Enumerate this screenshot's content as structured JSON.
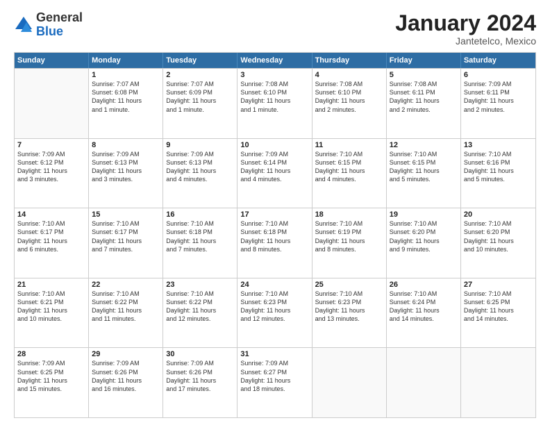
{
  "logo": {
    "general": "General",
    "blue": "Blue"
  },
  "title": "January 2024",
  "subtitle": "Jantetelco, Mexico",
  "header": {
    "days": [
      "Sunday",
      "Monday",
      "Tuesday",
      "Wednesday",
      "Thursday",
      "Friday",
      "Saturday"
    ]
  },
  "weeks": [
    [
      {
        "day": "",
        "info": ""
      },
      {
        "day": "1",
        "info": "Sunrise: 7:07 AM\nSunset: 6:08 PM\nDaylight: 11 hours\nand 1 minute."
      },
      {
        "day": "2",
        "info": "Sunrise: 7:07 AM\nSunset: 6:09 PM\nDaylight: 11 hours\nand 1 minute."
      },
      {
        "day": "3",
        "info": "Sunrise: 7:08 AM\nSunset: 6:10 PM\nDaylight: 11 hours\nand 1 minute."
      },
      {
        "day": "4",
        "info": "Sunrise: 7:08 AM\nSunset: 6:10 PM\nDaylight: 11 hours\nand 2 minutes."
      },
      {
        "day": "5",
        "info": "Sunrise: 7:08 AM\nSunset: 6:11 PM\nDaylight: 11 hours\nand 2 minutes."
      },
      {
        "day": "6",
        "info": "Sunrise: 7:09 AM\nSunset: 6:11 PM\nDaylight: 11 hours\nand 2 minutes."
      }
    ],
    [
      {
        "day": "7",
        "info": "Sunrise: 7:09 AM\nSunset: 6:12 PM\nDaylight: 11 hours\nand 3 minutes."
      },
      {
        "day": "8",
        "info": "Sunrise: 7:09 AM\nSunset: 6:13 PM\nDaylight: 11 hours\nand 3 minutes."
      },
      {
        "day": "9",
        "info": "Sunrise: 7:09 AM\nSunset: 6:13 PM\nDaylight: 11 hours\nand 4 minutes."
      },
      {
        "day": "10",
        "info": "Sunrise: 7:09 AM\nSunset: 6:14 PM\nDaylight: 11 hours\nand 4 minutes."
      },
      {
        "day": "11",
        "info": "Sunrise: 7:10 AM\nSunset: 6:15 PM\nDaylight: 11 hours\nand 4 minutes."
      },
      {
        "day": "12",
        "info": "Sunrise: 7:10 AM\nSunset: 6:15 PM\nDaylight: 11 hours\nand 5 minutes."
      },
      {
        "day": "13",
        "info": "Sunrise: 7:10 AM\nSunset: 6:16 PM\nDaylight: 11 hours\nand 5 minutes."
      }
    ],
    [
      {
        "day": "14",
        "info": "Sunrise: 7:10 AM\nSunset: 6:17 PM\nDaylight: 11 hours\nand 6 minutes."
      },
      {
        "day": "15",
        "info": "Sunrise: 7:10 AM\nSunset: 6:17 PM\nDaylight: 11 hours\nand 7 minutes."
      },
      {
        "day": "16",
        "info": "Sunrise: 7:10 AM\nSunset: 6:18 PM\nDaylight: 11 hours\nand 7 minutes."
      },
      {
        "day": "17",
        "info": "Sunrise: 7:10 AM\nSunset: 6:18 PM\nDaylight: 11 hours\nand 8 minutes."
      },
      {
        "day": "18",
        "info": "Sunrise: 7:10 AM\nSunset: 6:19 PM\nDaylight: 11 hours\nand 8 minutes."
      },
      {
        "day": "19",
        "info": "Sunrise: 7:10 AM\nSunset: 6:20 PM\nDaylight: 11 hours\nand 9 minutes."
      },
      {
        "day": "20",
        "info": "Sunrise: 7:10 AM\nSunset: 6:20 PM\nDaylight: 11 hours\nand 10 minutes."
      }
    ],
    [
      {
        "day": "21",
        "info": "Sunrise: 7:10 AM\nSunset: 6:21 PM\nDaylight: 11 hours\nand 10 minutes."
      },
      {
        "day": "22",
        "info": "Sunrise: 7:10 AM\nSunset: 6:22 PM\nDaylight: 11 hours\nand 11 minutes."
      },
      {
        "day": "23",
        "info": "Sunrise: 7:10 AM\nSunset: 6:22 PM\nDaylight: 11 hours\nand 12 minutes."
      },
      {
        "day": "24",
        "info": "Sunrise: 7:10 AM\nSunset: 6:23 PM\nDaylight: 11 hours\nand 12 minutes."
      },
      {
        "day": "25",
        "info": "Sunrise: 7:10 AM\nSunset: 6:23 PM\nDaylight: 11 hours\nand 13 minutes."
      },
      {
        "day": "26",
        "info": "Sunrise: 7:10 AM\nSunset: 6:24 PM\nDaylight: 11 hours\nand 14 minutes."
      },
      {
        "day": "27",
        "info": "Sunrise: 7:10 AM\nSunset: 6:25 PM\nDaylight: 11 hours\nand 14 minutes."
      }
    ],
    [
      {
        "day": "28",
        "info": "Sunrise: 7:09 AM\nSunset: 6:25 PM\nDaylight: 11 hours\nand 15 minutes."
      },
      {
        "day": "29",
        "info": "Sunrise: 7:09 AM\nSunset: 6:26 PM\nDaylight: 11 hours\nand 16 minutes."
      },
      {
        "day": "30",
        "info": "Sunrise: 7:09 AM\nSunset: 6:26 PM\nDaylight: 11 hours\nand 17 minutes."
      },
      {
        "day": "31",
        "info": "Sunrise: 7:09 AM\nSunset: 6:27 PM\nDaylight: 11 hours\nand 18 minutes."
      },
      {
        "day": "",
        "info": ""
      },
      {
        "day": "",
        "info": ""
      },
      {
        "day": "",
        "info": ""
      }
    ]
  ]
}
